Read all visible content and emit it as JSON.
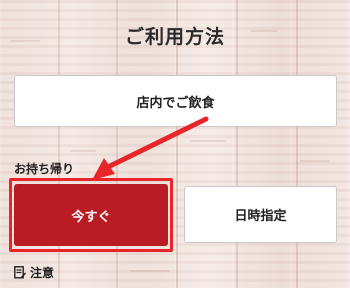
{
  "page": {
    "title": "ご利用方法"
  },
  "options": {
    "dine_in_label": "店内でご飲食",
    "takeout_section_label": "お持ち帰り",
    "now_label": "今すぐ",
    "datetime_label": "日時指定"
  },
  "notes": {
    "label": "注意",
    "icon": "memo-icon"
  },
  "colors": {
    "primary_button": "#b91c24",
    "highlight": "#e8262a"
  }
}
